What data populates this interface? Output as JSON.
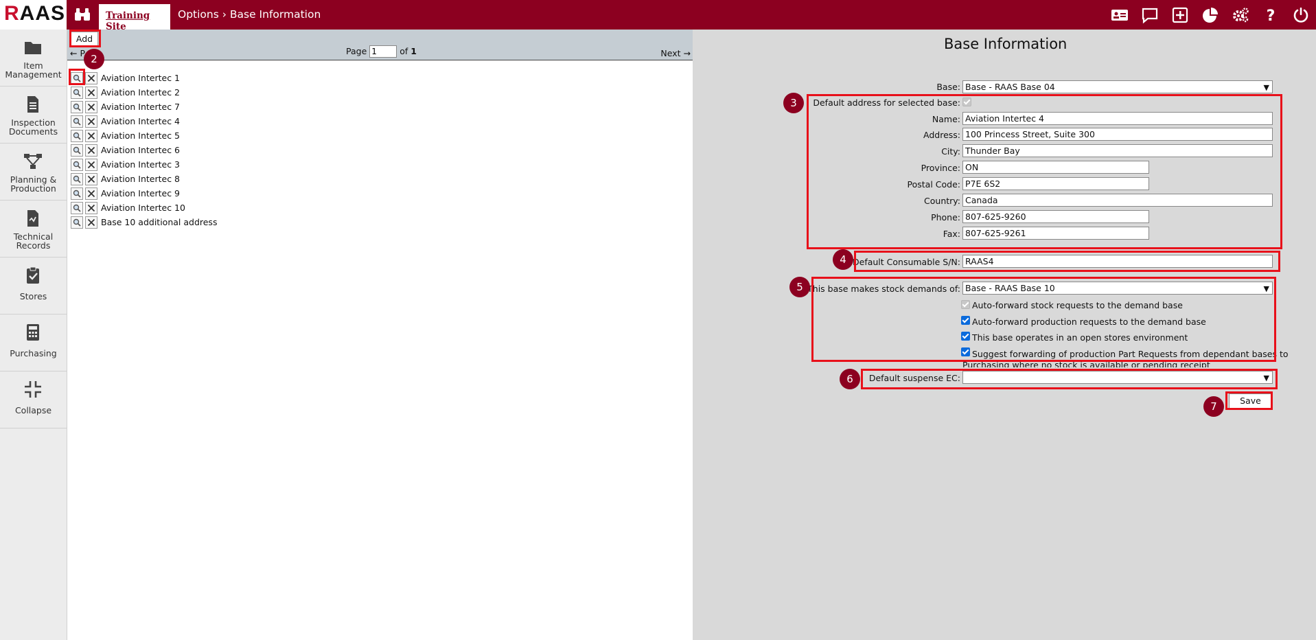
{
  "app": {
    "logo_r": "R",
    "logo_rest": "AAS",
    "site_tab": "Training Site",
    "breadcrumb_parent": "Options",
    "breadcrumb_sep": "›",
    "breadcrumb_current": "Base Information"
  },
  "top_icons": [
    "id-card-icon",
    "chat-icon",
    "plus-square-icon",
    "pie-chart-icon",
    "gears-icon",
    "help-icon",
    "power-icon"
  ],
  "sidebar": {
    "items": [
      {
        "label": "Item Management",
        "icon": "folder-icon"
      },
      {
        "label": "Inspection Documents",
        "icon": "document-icon"
      },
      {
        "label": "Planning & Production",
        "icon": "workflow-icon"
      },
      {
        "label": "Technical Records",
        "icon": "records-icon"
      },
      {
        "label": "Stores",
        "icon": "clipboard-check-icon"
      },
      {
        "label": "Purchasing",
        "icon": "calculator-icon"
      },
      {
        "label": "Collapse",
        "icon": "collapse-icon"
      }
    ]
  },
  "list": {
    "add_label": "Add",
    "prev_label": "← P",
    "page_label": "Page",
    "page_value": "1",
    "of_label": "of",
    "page_total": "1",
    "next_label": "Next →",
    "rows": [
      "Aviation Intertec 1",
      "Aviation Intertec 2",
      "Aviation Intertec 7",
      "Aviation Intertec 4",
      "Aviation Intertec 5",
      "Aviation Intertec 6",
      "Aviation Intertec 3",
      "Aviation Intertec 8",
      "Aviation Intertec 9",
      "Aviation Intertec 10",
      "Base 10 additional address"
    ]
  },
  "detail": {
    "title": "Base Information",
    "base_label": "Base:",
    "base_value": "Base - RAAS Base 04",
    "default_address_label": "Default address for selected base:",
    "name_label": "Name:",
    "name_value": "Aviation Intertec 4",
    "address_label": "Address:",
    "address_value": "100 Princess Street, Suite 300",
    "city_label": "City:",
    "city_value": "Thunder Bay",
    "province_label": "Province:",
    "province_value": "ON",
    "postal_label": "Postal Code:",
    "postal_value": "P7E 6S2",
    "country_label": "Country:",
    "country_value": "Canada",
    "phone_label": "Phone:",
    "phone_value": "807-625-9260",
    "fax_label": "Fax:",
    "fax_value": "807-625-9261",
    "consumable_label": "Default Consumable S/N:",
    "consumable_value": "RAAS4",
    "demands_label": "This base makes stock demands of:",
    "demands_value": "Base - RAAS Base 10",
    "opt1": "Auto-forward stock requests to the demand base",
    "opt2": "Auto-forward production requests to the demand base",
    "opt3": "This base operates in an open stores environment",
    "opt4a": "Suggest forwarding of production Part Requests from dependant bases to",
    "opt4b": "Purchasing where no stock is available or pending receipt",
    "suspense_label": "Default suspense EC:",
    "suspense_value": "",
    "save_label": "Save"
  },
  "annotations": [
    "2",
    "3",
    "4",
    "5",
    "6",
    "7"
  ],
  "colors": {
    "brand": "#8c0020",
    "highlight": "#e8101a",
    "checkbox": "#0b6bdc"
  }
}
